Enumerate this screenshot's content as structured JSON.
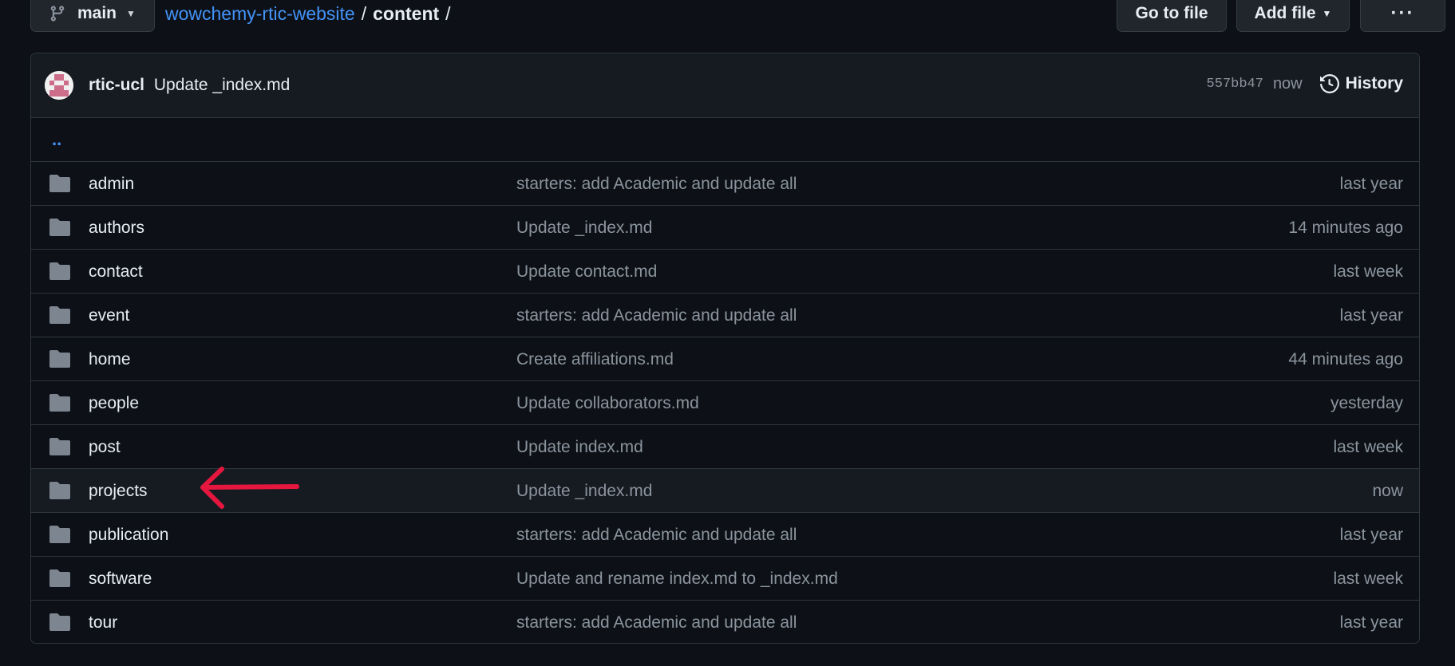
{
  "toolbar": {
    "branch_label": "main",
    "breadcrumb_repo": "wowchemy-rtic-website",
    "breadcrumb_sep1": "/",
    "breadcrumb_current": "content",
    "breadcrumb_sep2": "/",
    "goto_file_label": "Go to file",
    "add_file_label": "Add file",
    "more_label": "···"
  },
  "latest_commit": {
    "author": "rtic-ucl",
    "message": "Update _index.md",
    "sha": "557bb47",
    "time": "now",
    "history_label": "History"
  },
  "parent_dir_label": "..",
  "files": [
    {
      "name": "admin",
      "message": "starters: add Academic and update all",
      "age": "last year"
    },
    {
      "name": "authors",
      "message": "Update _index.md",
      "age": "14 minutes ago"
    },
    {
      "name": "contact",
      "message": "Update contact.md",
      "age": "last week"
    },
    {
      "name": "event",
      "message": "starters: add Academic and update all",
      "age": "last year"
    },
    {
      "name": "home",
      "message": "Create affiliations.md",
      "age": "44 minutes ago"
    },
    {
      "name": "people",
      "message": "Update collaborators.md",
      "age": "yesterday"
    },
    {
      "name": "post",
      "message": "Update index.md",
      "age": "last week"
    },
    {
      "name": "projects",
      "message": "Update _index.md",
      "age": "now"
    },
    {
      "name": "publication",
      "message": "starters: add Academic and update all",
      "age": "last year"
    },
    {
      "name": "software",
      "message": "Update and rename index.md to _index.md",
      "age": "last week"
    },
    {
      "name": "tour",
      "message": "starters: add Academic and update all",
      "age": "last year"
    }
  ],
  "icons": {
    "branch": "git-branch-icon",
    "folder": "folder-icon",
    "history": "history-clock-icon",
    "annotation": "red-arrow-annotation"
  },
  "colors": {
    "background": "#0d1117",
    "link": "#4493f8",
    "muted": "#8b949e",
    "folder": "#7d8590",
    "annotation": "#e5173f"
  }
}
